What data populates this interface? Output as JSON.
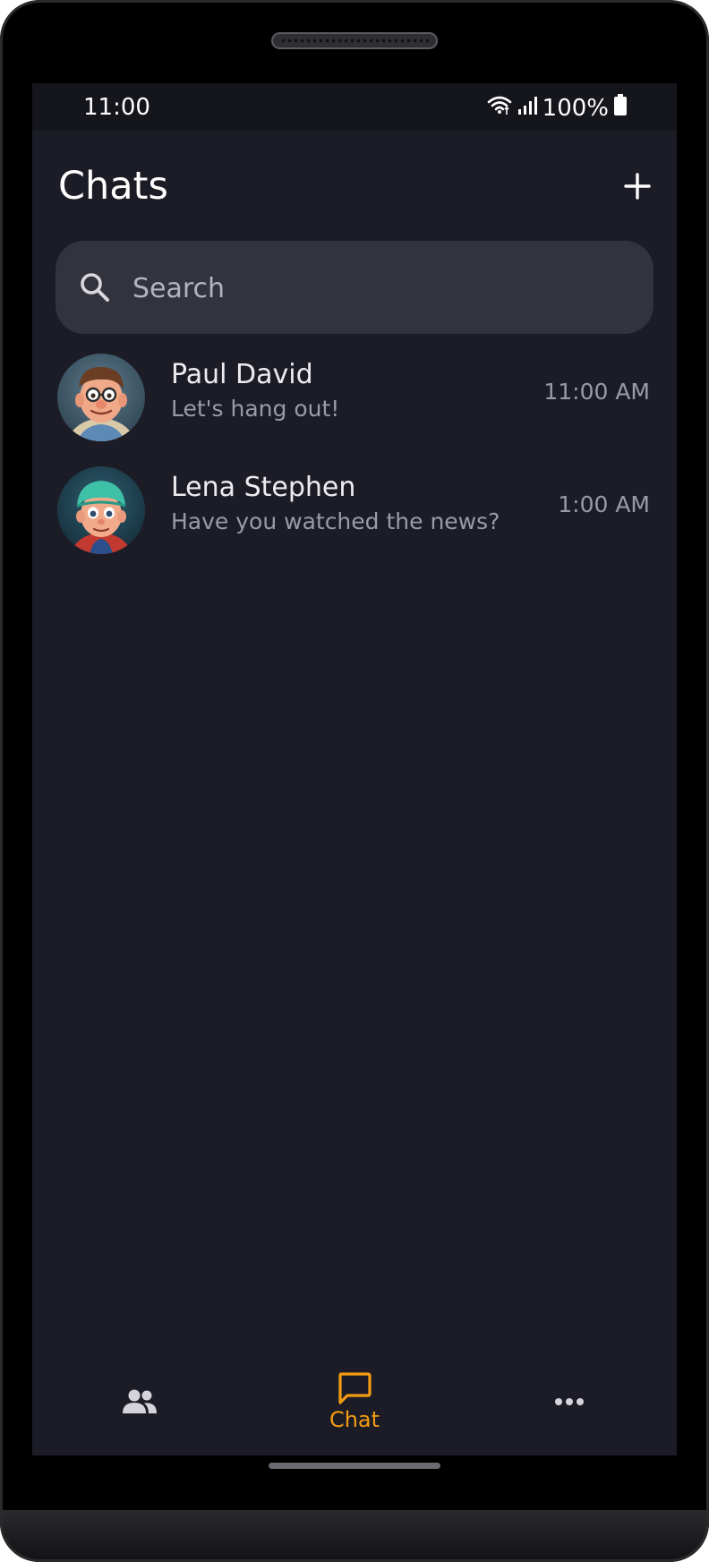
{
  "status_bar": {
    "time": "11:00",
    "battery": "100%",
    "icons": [
      "wifi-icon",
      "signal-icon",
      "battery-icon"
    ]
  },
  "header": {
    "title": "Chats",
    "add_icon": "plus-icon"
  },
  "search": {
    "placeholder": "Search",
    "value": "",
    "icon": "search-icon"
  },
  "chats": [
    {
      "name": "Paul David",
      "preview": "Let's hang out!",
      "time": "11:00 AM",
      "avatar": "avatar-paul"
    },
    {
      "name": "Lena Stephen",
      "preview": "Have you watched the news?",
      "time": "1:00 AM",
      "avatar": "avatar-lena"
    }
  ],
  "bottom_nav": {
    "items": [
      {
        "icon": "people-icon",
        "label": "",
        "active": false
      },
      {
        "icon": "chat-bubble-icon",
        "label": "Chat",
        "active": true
      },
      {
        "icon": "more-horizontal-icon",
        "label": "",
        "active": false
      }
    ]
  },
  "colors": {
    "background": "#1c1c27",
    "status_bar": "#15151c",
    "search_box": "#33333e",
    "accent": "#f39c12",
    "primary_text": "#ececf0",
    "secondary_text": "#9b9ba6"
  }
}
